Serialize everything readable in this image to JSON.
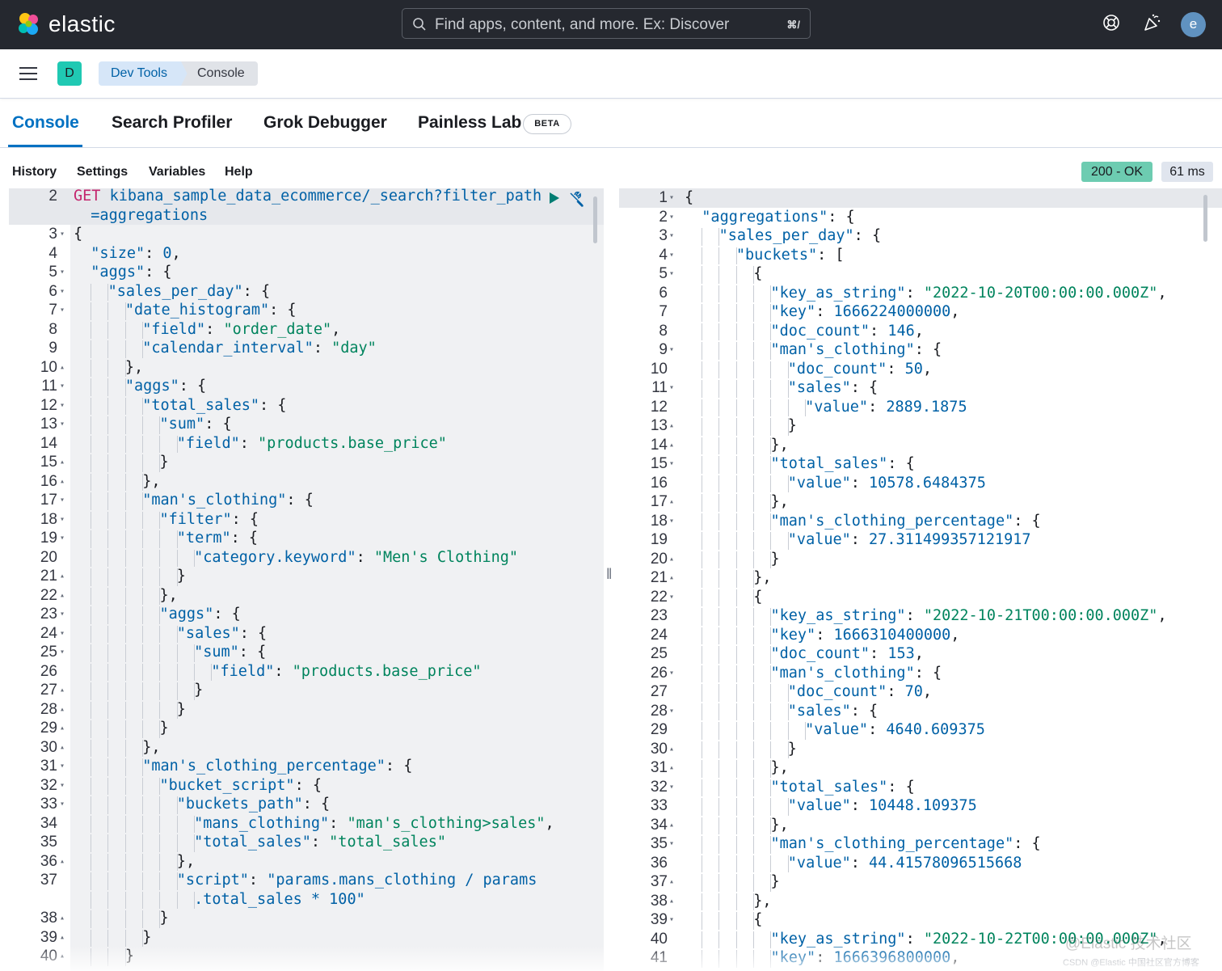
{
  "header": {
    "logo_text": "elastic",
    "search_placeholder": "Find apps, content, and more. Ex: Discover",
    "search_shortcut": "⌘/",
    "avatar_initial": "e"
  },
  "subheader": {
    "space_initial": "D",
    "breadcrumbs": [
      "Dev Tools",
      "Console"
    ]
  },
  "tabs": [
    {
      "label": "Console",
      "active": true
    },
    {
      "label": "Search Profiler",
      "active": false
    },
    {
      "label": "Grok Debugger",
      "active": false
    },
    {
      "label": "Painless Lab",
      "active": false
    }
  ],
  "beta_badge": "BETA",
  "console_menu": [
    "History",
    "Settings",
    "Variables",
    "Help"
  ],
  "response_status": "200 - OK",
  "response_time": "61 ms",
  "request_editor": {
    "lines": [
      {
        "num": "2",
        "fold": "",
        "indent": 0,
        "text": "GET kibana_sample_data_ecommerce/_search?filter_path"
      },
      {
        "num": "",
        "fold": "",
        "indent": 1,
        "text": "=aggregations"
      },
      {
        "num": "3",
        "fold": "▾",
        "indent": 0,
        "text": "{"
      },
      {
        "num": "4",
        "fold": "",
        "indent": 1,
        "text": "\"size\": 0,"
      },
      {
        "num": "5",
        "fold": "▾",
        "indent": 1,
        "text": "\"aggs\": {"
      },
      {
        "num": "6",
        "fold": "▾",
        "indent": 2,
        "text": "\"sales_per_day\": {"
      },
      {
        "num": "7",
        "fold": "▾",
        "indent": 3,
        "text": "\"date_histogram\": {"
      },
      {
        "num": "8",
        "fold": "",
        "indent": 4,
        "text": "\"field\": \"order_date\","
      },
      {
        "num": "9",
        "fold": "",
        "indent": 4,
        "text": "\"calendar_interval\": \"day\""
      },
      {
        "num": "10",
        "fold": "▴",
        "indent": 3,
        "text": "},"
      },
      {
        "num": "11",
        "fold": "▾",
        "indent": 3,
        "text": "\"aggs\": {"
      },
      {
        "num": "12",
        "fold": "▾",
        "indent": 4,
        "text": "\"total_sales\": {"
      },
      {
        "num": "13",
        "fold": "▾",
        "indent": 5,
        "text": "\"sum\": {"
      },
      {
        "num": "14",
        "fold": "",
        "indent": 6,
        "text": "\"field\": \"products.base_price\""
      },
      {
        "num": "15",
        "fold": "▴",
        "indent": 5,
        "text": "}"
      },
      {
        "num": "16",
        "fold": "▴",
        "indent": 4,
        "text": "},"
      },
      {
        "num": "17",
        "fold": "▾",
        "indent": 4,
        "text": "\"man's_clothing\": {"
      },
      {
        "num": "18",
        "fold": "▾",
        "indent": 5,
        "text": "\"filter\": {"
      },
      {
        "num": "19",
        "fold": "▾",
        "indent": 6,
        "text": "\"term\": {"
      },
      {
        "num": "20",
        "fold": "",
        "indent": 7,
        "text": "\"category.keyword\": \"Men's Clothing\""
      },
      {
        "num": "21",
        "fold": "▴",
        "indent": 6,
        "text": "}"
      },
      {
        "num": "22",
        "fold": "▴",
        "indent": 5,
        "text": "},"
      },
      {
        "num": "23",
        "fold": "▾",
        "indent": 5,
        "text": "\"aggs\": {"
      },
      {
        "num": "24",
        "fold": "▾",
        "indent": 6,
        "text": "\"sales\": {"
      },
      {
        "num": "25",
        "fold": "▾",
        "indent": 7,
        "text": "\"sum\": {"
      },
      {
        "num": "26",
        "fold": "",
        "indent": 8,
        "text": "\"field\": \"products.base_price\""
      },
      {
        "num": "27",
        "fold": "▴",
        "indent": 7,
        "text": "}"
      },
      {
        "num": "28",
        "fold": "▴",
        "indent": 6,
        "text": "}"
      },
      {
        "num": "29",
        "fold": "▴",
        "indent": 5,
        "text": "}"
      },
      {
        "num": "30",
        "fold": "▴",
        "indent": 4,
        "text": "},"
      },
      {
        "num": "31",
        "fold": "▾",
        "indent": 4,
        "text": "\"man's_clothing_percentage\": {"
      },
      {
        "num": "32",
        "fold": "▾",
        "indent": 5,
        "text": "\"bucket_script\": {"
      },
      {
        "num": "33",
        "fold": "▾",
        "indent": 6,
        "text": "\"buckets_path\": {"
      },
      {
        "num": "34",
        "fold": "",
        "indent": 7,
        "text": "\"mans_clothing\": \"man's_clothing>sales\","
      },
      {
        "num": "35",
        "fold": "",
        "indent": 7,
        "text": "\"total_sales\": \"total_sales\""
      },
      {
        "num": "36",
        "fold": "▴",
        "indent": 6,
        "text": "},"
      },
      {
        "num": "37",
        "fold": "",
        "indent": 6,
        "text": "\"script\": \"params.mans_clothing / params"
      },
      {
        "num": "",
        "fold": "",
        "indent": 7,
        "text": ".total_sales * 100\""
      },
      {
        "num": "38",
        "fold": "▴",
        "indent": 5,
        "text": "}"
      },
      {
        "num": "39",
        "fold": "▴",
        "indent": 4,
        "text": "}"
      },
      {
        "num": "40",
        "fold": "▴",
        "indent": 3,
        "text": "}"
      }
    ]
  },
  "response_editor": {
    "lines": [
      {
        "num": "1",
        "fold": "▾",
        "indent": 0,
        "text": "{"
      },
      {
        "num": "2",
        "fold": "▾",
        "indent": 1,
        "text": "\"aggregations\": {"
      },
      {
        "num": "3",
        "fold": "▾",
        "indent": 2,
        "text": "\"sales_per_day\": {"
      },
      {
        "num": "4",
        "fold": "▾",
        "indent": 3,
        "text": "\"buckets\": ["
      },
      {
        "num": "5",
        "fold": "▾",
        "indent": 4,
        "text": "{"
      },
      {
        "num": "6",
        "fold": "",
        "indent": 5,
        "text": "\"key_as_string\": \"2022-10-20T00:00:00.000Z\","
      },
      {
        "num": "7",
        "fold": "",
        "indent": 5,
        "text": "\"key\": 1666224000000,"
      },
      {
        "num": "8",
        "fold": "",
        "indent": 5,
        "text": "\"doc_count\": 146,"
      },
      {
        "num": "9",
        "fold": "▾",
        "indent": 5,
        "text": "\"man's_clothing\": {"
      },
      {
        "num": "10",
        "fold": "",
        "indent": 6,
        "text": "\"doc_count\": 50,"
      },
      {
        "num": "11",
        "fold": "▾",
        "indent": 6,
        "text": "\"sales\": {"
      },
      {
        "num": "12",
        "fold": "",
        "indent": 7,
        "text": "\"value\": 2889.1875"
      },
      {
        "num": "13",
        "fold": "▴",
        "indent": 6,
        "text": "}"
      },
      {
        "num": "14",
        "fold": "▴",
        "indent": 5,
        "text": "},"
      },
      {
        "num": "15",
        "fold": "▾",
        "indent": 5,
        "text": "\"total_sales\": {"
      },
      {
        "num": "16",
        "fold": "",
        "indent": 6,
        "text": "\"value\": 10578.6484375"
      },
      {
        "num": "17",
        "fold": "▴",
        "indent": 5,
        "text": "},"
      },
      {
        "num": "18",
        "fold": "▾",
        "indent": 5,
        "text": "\"man's_clothing_percentage\": {"
      },
      {
        "num": "19",
        "fold": "",
        "indent": 6,
        "text": "\"value\": 27.311499357121917"
      },
      {
        "num": "20",
        "fold": "▴",
        "indent": 5,
        "text": "}"
      },
      {
        "num": "21",
        "fold": "▴",
        "indent": 4,
        "text": "},"
      },
      {
        "num": "22",
        "fold": "▾",
        "indent": 4,
        "text": "{"
      },
      {
        "num": "23",
        "fold": "",
        "indent": 5,
        "text": "\"key_as_string\": \"2022-10-21T00:00:00.000Z\","
      },
      {
        "num": "24",
        "fold": "",
        "indent": 5,
        "text": "\"key\": 1666310400000,"
      },
      {
        "num": "25",
        "fold": "",
        "indent": 5,
        "text": "\"doc_count\": 153,"
      },
      {
        "num": "26",
        "fold": "▾",
        "indent": 5,
        "text": "\"man's_clothing\": {"
      },
      {
        "num": "27",
        "fold": "",
        "indent": 6,
        "text": "\"doc_count\": 70,"
      },
      {
        "num": "28",
        "fold": "▾",
        "indent": 6,
        "text": "\"sales\": {"
      },
      {
        "num": "29",
        "fold": "",
        "indent": 7,
        "text": "\"value\": 4640.609375"
      },
      {
        "num": "30",
        "fold": "▴",
        "indent": 6,
        "text": "}"
      },
      {
        "num": "31",
        "fold": "▴",
        "indent": 5,
        "text": "},"
      },
      {
        "num": "32",
        "fold": "▾",
        "indent": 5,
        "text": "\"total_sales\": {"
      },
      {
        "num": "33",
        "fold": "",
        "indent": 6,
        "text": "\"value\": 10448.109375"
      },
      {
        "num": "34",
        "fold": "▴",
        "indent": 5,
        "text": "},"
      },
      {
        "num": "35",
        "fold": "▾",
        "indent": 5,
        "text": "\"man's_clothing_percentage\": {"
      },
      {
        "num": "36",
        "fold": "",
        "indent": 6,
        "text": "\"value\": 44.41578096515668"
      },
      {
        "num": "37",
        "fold": "▴",
        "indent": 5,
        "text": "}"
      },
      {
        "num": "38",
        "fold": "▴",
        "indent": 4,
        "text": "},"
      },
      {
        "num": "39",
        "fold": "▾",
        "indent": 4,
        "text": "{"
      },
      {
        "num": "40",
        "fold": "",
        "indent": 5,
        "text": "\"key_as_string\": \"2022-10-22T00:00:00.000Z\","
      },
      {
        "num": "41",
        "fold": "",
        "indent": 5,
        "text": "\"key\": 1666396800000,"
      }
    ]
  },
  "watermark": {
    "main": "@Elastic 技术社区",
    "footer": "CSDN @Elastic 中国社区官方博客"
  },
  "colors": {
    "topbar": "#25282f",
    "accent": "#0071c2",
    "status_ok": "#6dccb1",
    "string": "#00845d",
    "key": "#0061a6",
    "method": "#c4256d"
  }
}
